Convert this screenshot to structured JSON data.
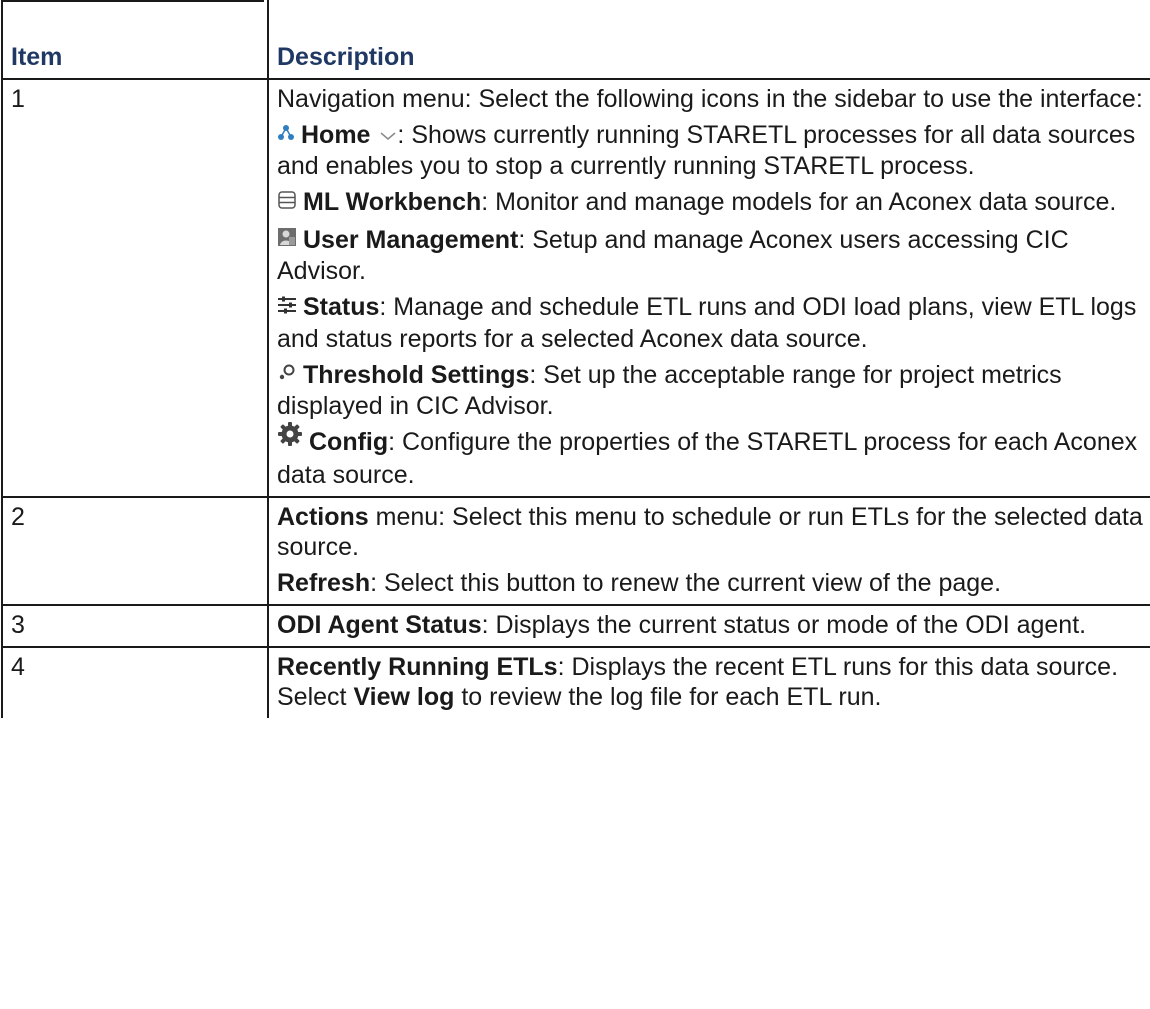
{
  "table": {
    "headers": {
      "item": "Item",
      "description": "Description"
    },
    "rows": [
      {
        "item": "1",
        "intro": "Navigation menu: Select the following icons in the sidebar to use the interface:",
        "entries": [
          {
            "icon": "home-icon",
            "title": "Home",
            "suffix": ": Shows currently running STARETL processes for all data sources and enables you to stop a currently running STARETL process."
          },
          {
            "icon": "database-icon",
            "title": "ML Workbench",
            "suffix": ": Monitor and manage models for an Aconex data source."
          },
          {
            "icon": "user-management-icon",
            "title": "User Management",
            "suffix": ": Setup and manage Aconex users accessing CIC Advisor."
          },
          {
            "icon": "sliders-icon",
            "title": "Status",
            "suffix": ": Manage and schedule ETL runs and ODI load plans, view ETL logs and status reports   for a selected Aconex data source."
          },
          {
            "icon": "threshold-icon",
            "title": "Threshold Settings",
            "suffix": ": Set up the acceptable range for project metrics displayed in CIC Advisor."
          },
          {
            "icon": "gear-icon",
            "title": "Config",
            "suffix": ": Configure the properties of the STARETL process for each Aconex data source."
          }
        ]
      },
      {
        "item": "2",
        "actions_title": "Actions",
        "actions_text": " menu: Select this menu to schedule or run ETLs for the selected data source.",
        "refresh_title": "Refresh",
        "refresh_text": ": Select this button to renew the current view of the page."
      },
      {
        "item": "3",
        "title": "ODI Agent Status",
        "text": ": Displays the current status or mode of the ODI agent."
      },
      {
        "item": "4",
        "title": "Recently Running ETLs",
        "text_a": ": Displays the recent ETL runs for this data source. Select ",
        "link_title": "View log",
        "text_b": " to review the log file for each ETL run."
      }
    ]
  },
  "colors": {
    "header_text": "#1f3864",
    "home_icon": "#2f7fc1",
    "border": "#1a1a1a"
  }
}
